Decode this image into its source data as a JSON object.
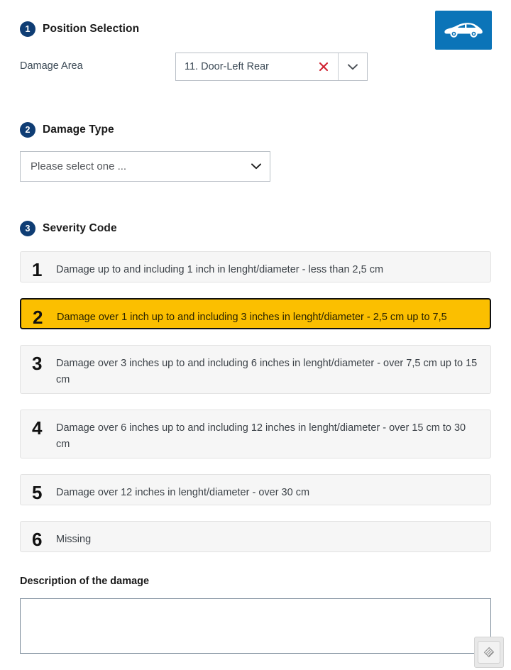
{
  "brand": {
    "accent_blue": "#0b74b8",
    "badge_navy": "#0f3d74",
    "selected_amber": "#fbbf00",
    "clear_red": "#d02030",
    "car_icon": "car-side-icon"
  },
  "section1": {
    "step": "1",
    "title": "Position Selection",
    "field_label": "Damage Area",
    "combo_value": "11. Door-Left Rear",
    "clear_icon": "close-x-icon",
    "arrow_icon": "chevron-down-icon"
  },
  "section2": {
    "step": "2",
    "title": "Damage Type",
    "select_value": "Please select one ...",
    "select_placeholder": "Please select one ...",
    "arrow_icon": "chevron-down-icon",
    "options": [
      "Please select one ..."
    ]
  },
  "section3": {
    "step": "3",
    "title": "Severity Code",
    "rows": [
      {
        "number": "1",
        "text": "Damage up to and including 1 inch in lenght/diameter - less than 2,5 cm",
        "selected": false
      },
      {
        "number": "2",
        "text": "Damage over 1 inch up to and including 3 inches in lenght/diameter - 2,5 cm up to 7,5",
        "selected": true
      },
      {
        "number": "3",
        "text": "Damage over 3 inches up to and including 6 inches in lenght/diameter - over 7,5 cm up to 15 cm",
        "selected": false
      },
      {
        "number": "4",
        "text": "Damage over 6 inches up to and including 12 inches in lenght/diameter - over 15 cm to 30 cm",
        "selected": false
      },
      {
        "number": "5",
        "text": "Damage over 12 inches in lenght/diameter - over 30 cm",
        "selected": false
      },
      {
        "number": "6",
        "text": "Missing",
        "selected": false
      }
    ]
  },
  "description": {
    "label": "Description of the damage",
    "value": "",
    "placeholder": "",
    "resize_icon": "resize-handle-icon"
  }
}
